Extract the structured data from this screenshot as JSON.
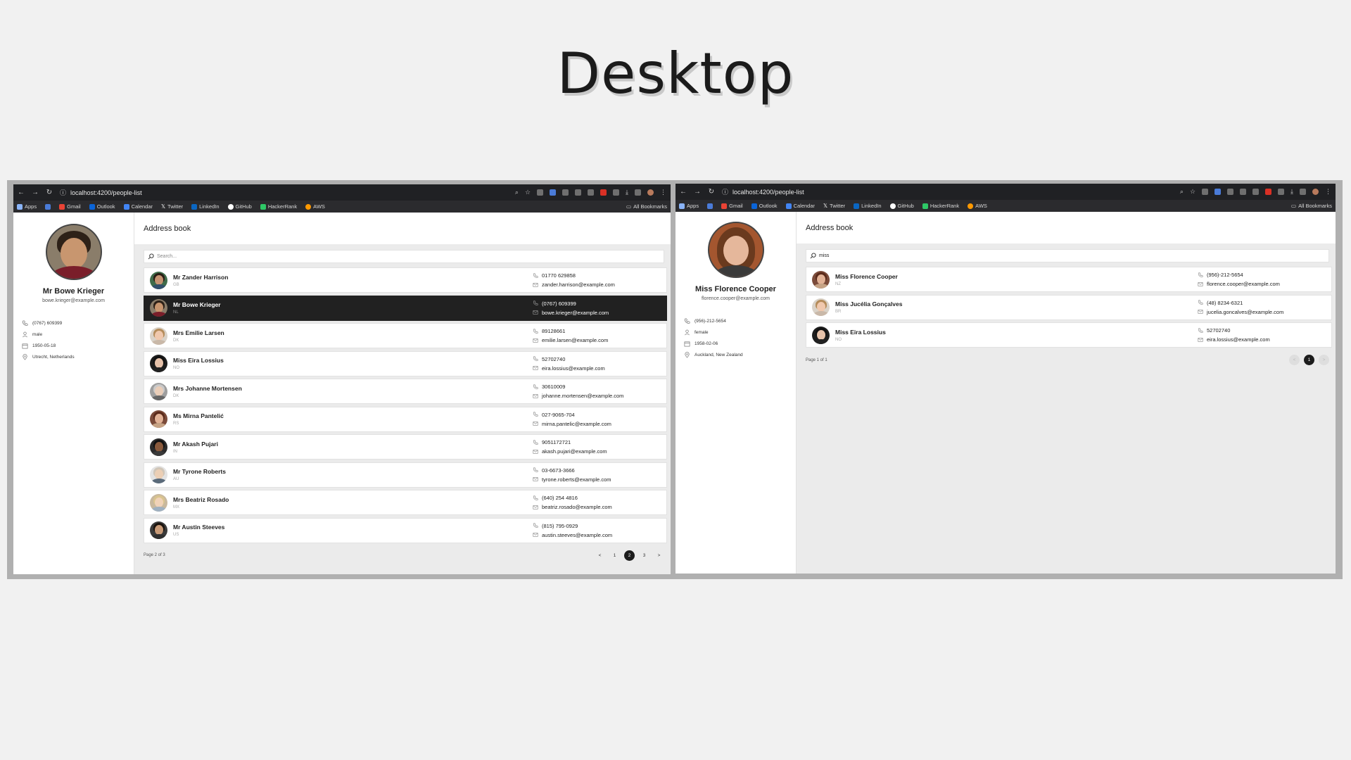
{
  "page": {
    "title": "Desktop"
  },
  "left": {
    "url": "localhost:4200/people-list",
    "bookmarks": [
      "Apps",
      "Gmail",
      "Outlook",
      "Calendar",
      "Twitter",
      "LinkedIn",
      "GitHub",
      "HackerRank",
      "AWS"
    ],
    "all_bookmarks": "All Bookmarks",
    "header": "Address book",
    "search_placeholder": "Search...",
    "profile": {
      "name": "Mr Bowe Krieger",
      "email": "bowe.krieger@example.com",
      "phone": "(0767) 609399",
      "gender": "male",
      "dob": "1950-05-18",
      "location": "Utrecht, Netherlands"
    },
    "people": [
      {
        "name": "Mr Zander Harrison",
        "country": "GB",
        "phone": "01770 629858",
        "email": "zander.harrison@example.com"
      },
      {
        "name": "Mr Bowe Krieger",
        "country": "NL",
        "phone": "(0767) 609399",
        "email": "bowe.krieger@example.com"
      },
      {
        "name": "Mrs Emilie Larsen",
        "country": "DK",
        "phone": "89128661",
        "email": "emilie.larsen@example.com"
      },
      {
        "name": "Miss Eira Lossius",
        "country": "NO",
        "phone": "52702740",
        "email": "eira.lossius@example.com"
      },
      {
        "name": "Mrs Johanne Mortensen",
        "country": "DK",
        "phone": "30610009",
        "email": "johanne.mortensen@example.com"
      },
      {
        "name": "Ms Mirna Pantelić",
        "country": "RS",
        "phone": "027-9065-704",
        "email": "mirna.pantelic@example.com"
      },
      {
        "name": "Mr Akash Pujari",
        "country": "IN",
        "phone": "9051172721",
        "email": "akash.pujari@example.com"
      },
      {
        "name": "Mr Tyrone Roberts",
        "country": "AU",
        "phone": "03-6673-3666",
        "email": "tyrone.roberts@example.com"
      },
      {
        "name": "Mrs Beatriz Rosado",
        "country": "MX",
        "phone": "(640) 254 4816",
        "email": "beatriz.rosado@example.com"
      },
      {
        "name": "Mr Austin Steeves",
        "country": "US",
        "phone": "(815) 795-0929",
        "email": "austin.steeves@example.com"
      }
    ],
    "page_info": "Page 2 of 3",
    "pager": [
      "<",
      "1",
      "2",
      "3",
      ">"
    ]
  },
  "right": {
    "url": "localhost:4200/people-list",
    "bookmarks": [
      "Apps",
      "Gmail",
      "Outlook",
      "Calendar",
      "Twitter",
      "LinkedIn",
      "GitHub",
      "HackerRank",
      "AWS"
    ],
    "all_bookmarks": "All Bookmarks",
    "header": "Address book",
    "search_value": "miss",
    "profile": {
      "name": "Miss Florence Cooper",
      "email": "florence.cooper@example.com",
      "phone": "(956)-212-5654",
      "gender": "female",
      "dob": "1958-02-06",
      "location": "Auckland, New Zealand"
    },
    "people": [
      {
        "name": "Miss Florence Cooper",
        "country": "NZ",
        "phone": "(956)-212-5654",
        "email": "florence.cooper@example.com"
      },
      {
        "name": "Miss Jucélia Gonçalves",
        "country": "BR",
        "phone": "(48) 8234-6321",
        "email": "jucelia.goncalves@example.com"
      },
      {
        "name": "Miss Eira Lossius",
        "country": "NO",
        "phone": "52702740",
        "email": "eira.lossius@example.com"
      }
    ],
    "page_info": "Page 1 of 1",
    "pager": [
      "<",
      "1",
      ">"
    ]
  },
  "colors": {
    "selected_row": "#212121",
    "chrome": "#202124",
    "frame": "#b0b0b0"
  }
}
